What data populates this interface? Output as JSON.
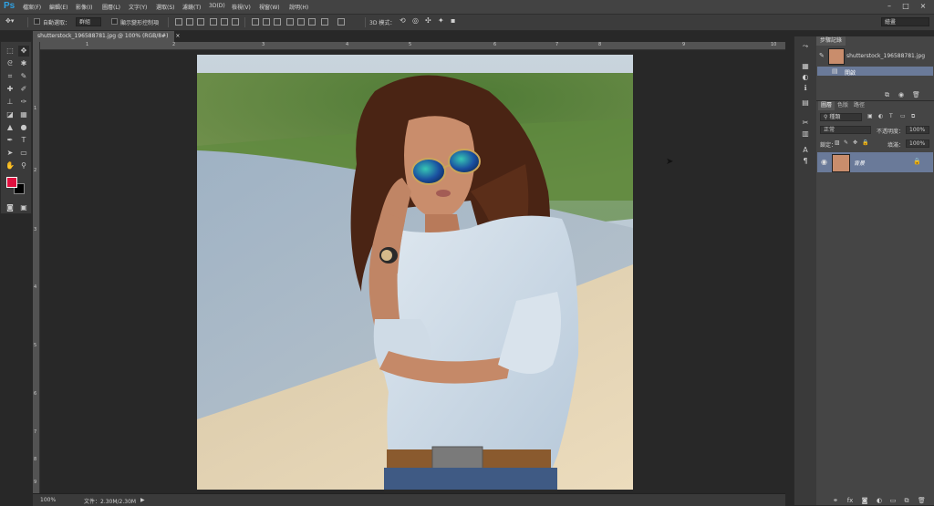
{
  "app": {
    "logo": "Ps"
  },
  "menu": [
    "檔案(F)",
    "編輯(E)",
    "影像(I)",
    "圖層(L)",
    "文字(Y)",
    "選取(S)",
    "濾鏡(T)",
    "3D(D)",
    "檢視(V)",
    "視窗(W)",
    "說明(H)"
  ],
  "window_controls": [
    "–",
    "□",
    "×"
  ],
  "options_bar": {
    "auto_select_label": "自動選取：",
    "auto_select_value": "群組",
    "show_transform_label": "顯示變形控制項",
    "mode_3d_label": "3D 模式：",
    "workspace": "繪畫"
  },
  "document": {
    "tab_title": "shutterstock_196588781.jpg @ 100% (RGB/8#)",
    "tab_close": "×",
    "ruler_numbers": [
      "1",
      "2",
      "3",
      "4",
      "5",
      "6",
      "7",
      "8",
      "9",
      "10"
    ],
    "ruler_left_numbers": [
      "1",
      "2",
      "3",
      "4",
      "5",
      "6",
      "7",
      "8",
      "9"
    ]
  },
  "status": {
    "zoom": "100%",
    "doc_size": "文件：2.30M/2.30M"
  },
  "colors": {
    "foreground": "#e0103f",
    "background": "#000000",
    "panel_selected": "#6a7a99",
    "ps_blue": "#2fa0e0"
  },
  "history_panel": {
    "tab": "步驟記錄",
    "snapshot": "shutterstock_196588781.jpg",
    "step": "開啟"
  },
  "layers_panel": {
    "tabs": [
      "圖層",
      "色版",
      "路徑"
    ],
    "kind_filter": "種類",
    "blend_mode": "正常",
    "opacity_label": "不透明度：",
    "opacity_value": "100%",
    "lock_label": "鎖定：",
    "fill_label": "填滿：",
    "fill_value": "100%",
    "layer_name": "背景"
  }
}
